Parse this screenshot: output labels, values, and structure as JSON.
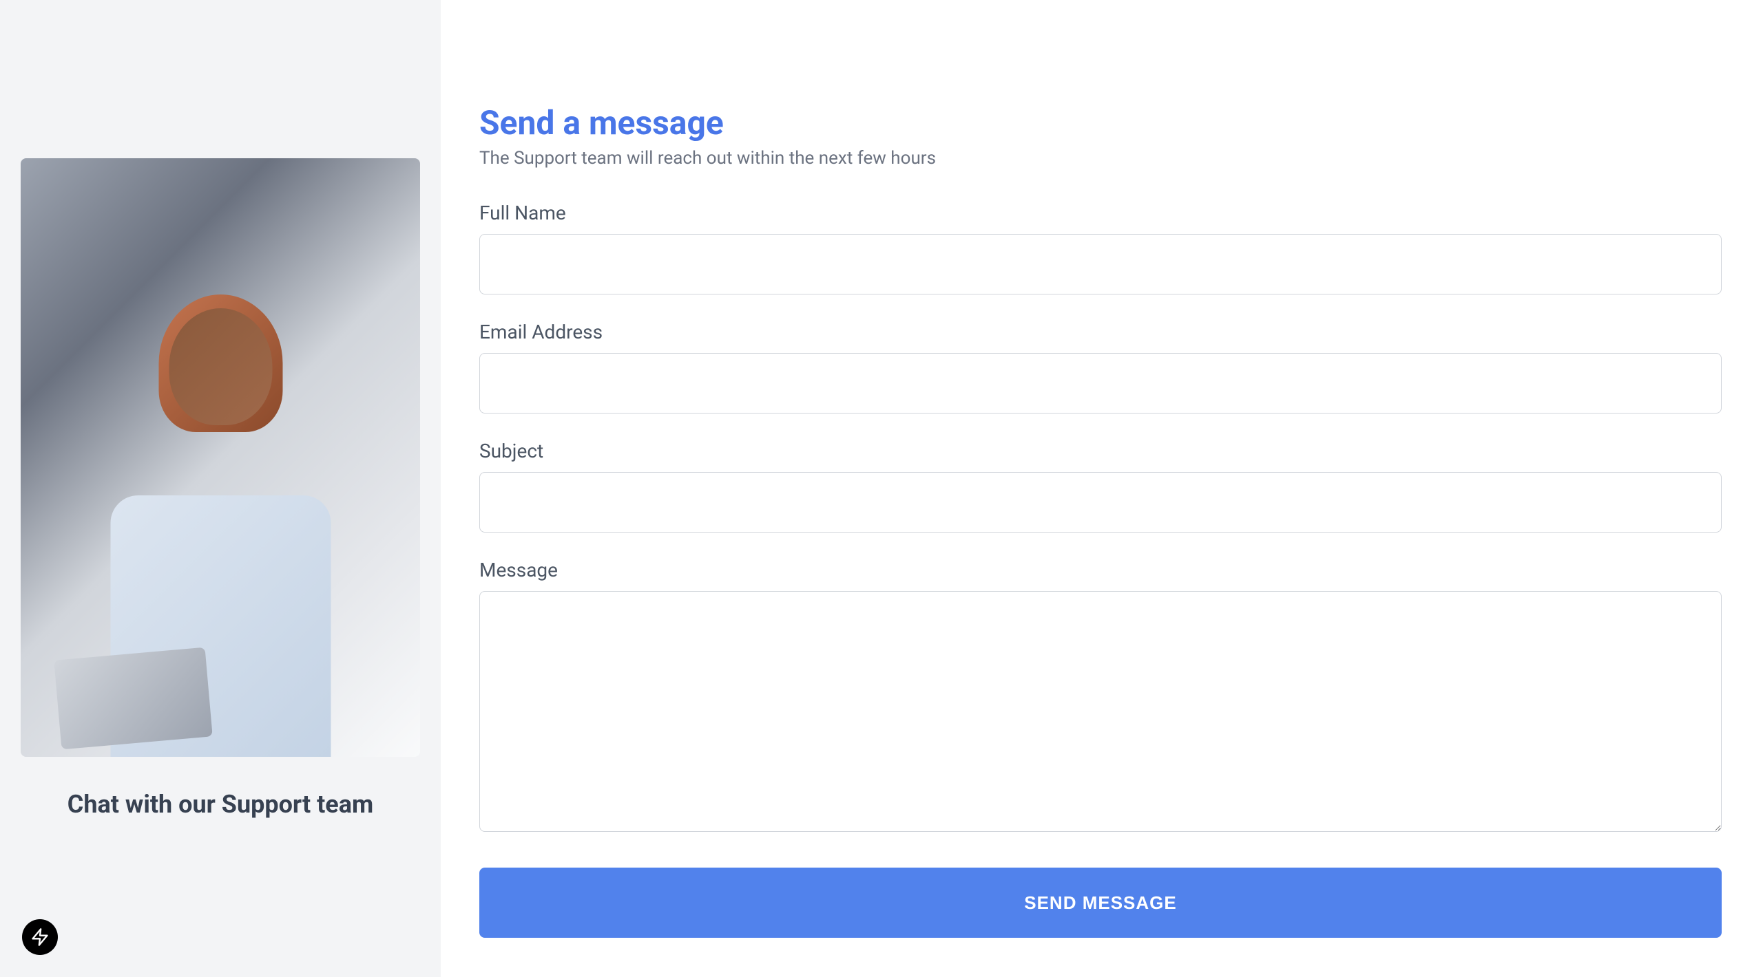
{
  "sidebar": {
    "title": "Chat with our Support team"
  },
  "form": {
    "title": "Send a message",
    "subtitle": "The Support team will reach out within the next few hours",
    "fields": {
      "fullName": {
        "label": "Full Name",
        "value": ""
      },
      "email": {
        "label": "Email Address",
        "value": ""
      },
      "subject": {
        "label": "Subject",
        "value": ""
      },
      "message": {
        "label": "Message",
        "value": ""
      }
    },
    "submitLabel": "SEND MESSAGE"
  },
  "colors": {
    "accent": "#4976e8",
    "buttonBg": "#5182ec"
  }
}
